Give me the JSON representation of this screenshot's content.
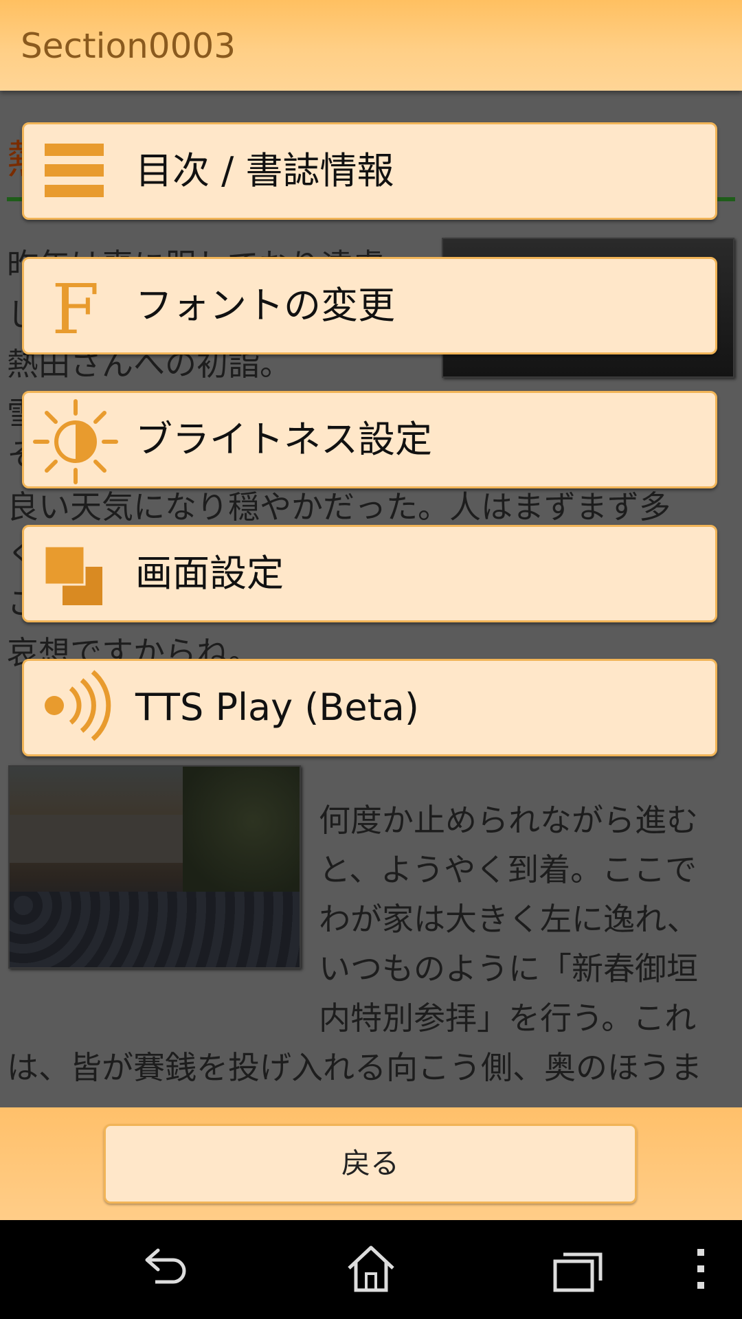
{
  "title_bar": {
    "title": "Section0003"
  },
  "article": {
    "heading_fragment": "熱",
    "lines": [
      {
        "text": "昨年は喪に服しており遠慮"
      },
      {
        "text": "し"
      },
      {
        "text": "熱田さんへの初詣。"
      },
      {
        "text": "雪"
      },
      {
        "text": "そ"
      },
      {
        "text": "良い天気になり穏やかだった。人はまずまず多"
      },
      {
        "text": "く"
      },
      {
        "text": "こ"
      },
      {
        "text": "哀想ですからね。"
      },
      {
        "text": "何度か止められながら進む"
      },
      {
        "text": "と、ようやく到着。ここで"
      },
      {
        "text": "わが家は大きく左に逸れ、"
      },
      {
        "text": "いつものように「新春御垣"
      },
      {
        "text": "内特別参拝」を行う。これ"
      },
      {
        "text": "は、皆が賽銭を投げ入れる向こう側、奥のほうま"
      }
    ]
  },
  "menu": {
    "items": [
      {
        "label": "目次 / 書誌情報",
        "icon": "list-icon"
      },
      {
        "label": "フォントの変更",
        "icon": "font-icon"
      },
      {
        "label": "ブライトネス設定",
        "icon": "brightness-icon"
      },
      {
        "label": "画面設定",
        "icon": "screen-icon"
      },
      {
        "label": "TTS Play (Beta)",
        "icon": "speaker-icon"
      }
    ]
  },
  "bottom_bar": {
    "back_label": "戻る"
  },
  "colors": {
    "accent": "#e89b2e",
    "button_bg": "#ffe7c9",
    "button_border": "#f1b457",
    "bar_bg": "#ffc06a"
  },
  "system_nav": {
    "icons": [
      "back-nav-icon",
      "home-nav-icon",
      "recents-nav-icon",
      "overflow-menu-icon"
    ]
  }
}
